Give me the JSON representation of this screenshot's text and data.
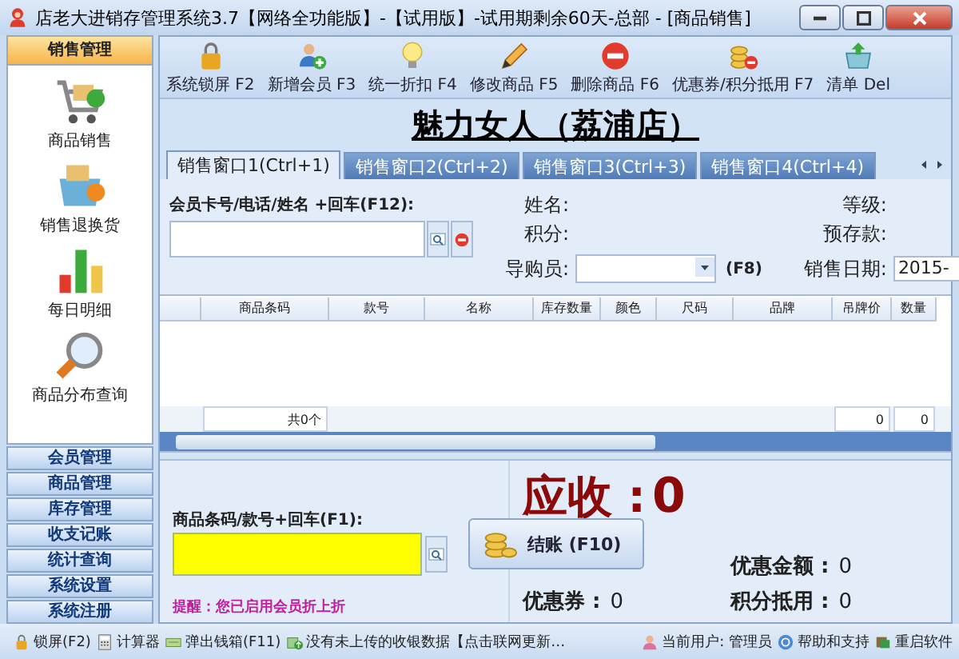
{
  "window": {
    "title": "店老大进销存管理系统3.7【网络全功能版】-【试用版】-试用期剩余60天-总部 - [商品销售]"
  },
  "sidebar": {
    "header": "销售管理",
    "items": [
      {
        "label": "商品销售"
      },
      {
        "label": "销售退换货"
      },
      {
        "label": "每日明细"
      },
      {
        "label": "商品分布查询"
      }
    ],
    "groups": [
      "会员管理",
      "商品管理",
      "库存管理",
      "收支记账",
      "统计查询",
      "系统设置",
      "系统注册"
    ]
  },
  "toolbar": [
    {
      "label": "系统锁屏 F2"
    },
    {
      "label": "新增会员 F3"
    },
    {
      "label": "统一折扣 F4"
    },
    {
      "label": "修改商品 F5"
    },
    {
      "label": "删除商品 F6"
    },
    {
      "label": "优惠券/积分抵用 F7"
    },
    {
      "label": "清单 Del"
    }
  ],
  "store_title": "魅力女人（荔浦店）",
  "tabs": [
    {
      "label": "销售窗口1(Ctrl+1)",
      "selected": true
    },
    {
      "label": "销售窗口2(Ctrl+2)",
      "selected": false
    },
    {
      "label": "销售窗口3(Ctrl+3)",
      "selected": false
    },
    {
      "label": "销售窗口4(Ctrl+4)",
      "selected": false
    }
  ],
  "member": {
    "search_label": "会员卡号/电话/姓名 +回车(F12):",
    "name_label": "姓名:",
    "points_label": "积分:",
    "level_label": "等级:",
    "deposit_label": "预存款:",
    "guide_label": "导购员:",
    "guide_key": "(F8)",
    "date_label": "销售日期:",
    "date_value": "2015-"
  },
  "table": {
    "columns": [
      "商品条码",
      "款号",
      "名称",
      "库存数量",
      "颜色",
      "尺码",
      "品牌",
      "吊牌价",
      "数量"
    ],
    "footer": {
      "count": "共0个",
      "tag_price_total": "0",
      "quantity_total": "0"
    }
  },
  "checkout": {
    "barcode_label": "商品条码/款号+回车(F1):",
    "reminder": "提醒：您已启用会员折上折",
    "button": "结账 (F10)",
    "due_label": "应收 :",
    "due_value": "0",
    "coupon_label": "优惠券 :",
    "coupon_value": "0",
    "discount_label": "优惠金额 :",
    "discount_value": "0",
    "points_label": "积分抵用 :",
    "points_value": "0"
  },
  "status_bar": [
    "锁屏(F2)",
    "计算器",
    "弹出钱箱(F11)",
    "没有未上传的收银数据【点击联网更新…",
    "当前用户: 管理员",
    "帮助和支持",
    "重启软件"
  ]
}
